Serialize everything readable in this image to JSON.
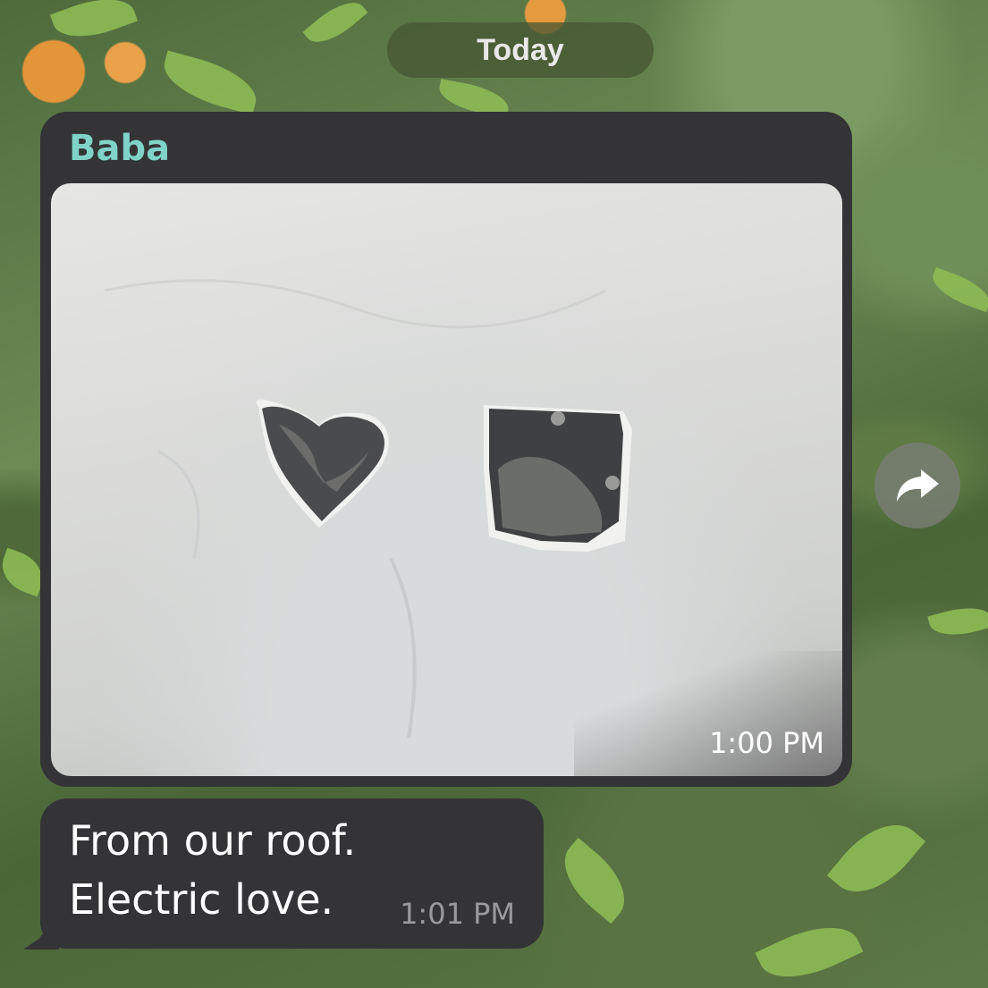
{
  "date_separator": "Today",
  "messages": [
    {
      "sender": "Baba",
      "type": "photo",
      "time": "1:00 PM"
    },
    {
      "type": "text",
      "lines": [
        "From our roof.",
        "Electric love."
      ],
      "time": "1:01 PM"
    }
  ],
  "share_button": {
    "icon": "share-arrow-icon"
  },
  "colors": {
    "bubble": "#343437",
    "sender_name": "#7fd3c7",
    "text": "#ffffff",
    "timestamp": "#9a9a9e"
  }
}
